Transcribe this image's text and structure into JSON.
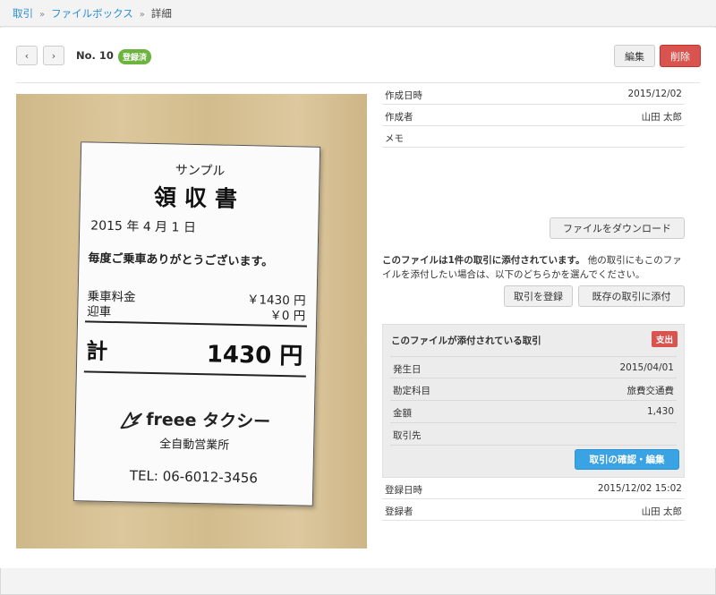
{
  "breadcrumb": {
    "items": [
      "取引",
      "ファイルボックス"
    ],
    "current": "詳細",
    "separator": "»"
  },
  "toolbar": {
    "prev_icon": "‹",
    "next_icon": "›",
    "doc_no": "No. 10",
    "status_badge": "登録済",
    "edit_label": "編集",
    "delete_label": "削除"
  },
  "receipt": {
    "sample": "サンプル",
    "title": "領収書",
    "date": "2015 年 4 月 1 日",
    "thanks": "毎度ご乗車ありがとうございます。",
    "fare_label": "乗車料金",
    "fare_value": "￥1430 円",
    "pickup_label": "迎車",
    "pickup_value": "￥0 円",
    "total_label": "計",
    "total_value": "1430 円",
    "brand": "freee タクシー",
    "office": "全自動営業所",
    "tel": "TEL: 06-6012-3456"
  },
  "file_info": [
    {
      "label": "作成日時",
      "value": "2015/12/02"
    },
    {
      "label": "作成者",
      "value": "山田 太郎"
    },
    {
      "label": "メモ",
      "value": ""
    }
  ],
  "download_label": "ファイルをダウンロード",
  "attach_note": {
    "bold": "このファイルは1件の取引に添付されています。",
    "rest": "他の取引にもこのファイルを添付したい場合は、以下のどちらかを選んでください。"
  },
  "register_deal_label": "取引を登録",
  "attach_existing_label": "既存の取引に添付",
  "deal": {
    "title": "このファイルが添付されている取引",
    "type_badge": "支出",
    "rows": [
      {
        "label": "発生日",
        "value": "2015/04/01"
      },
      {
        "label": "勘定科目",
        "value": "旅費交通費"
      },
      {
        "label": "金額",
        "value": "1,430"
      },
      {
        "label": "取引先",
        "value": ""
      }
    ],
    "confirm_label": "取引の確認・編集"
  },
  "registration": [
    {
      "label": "登録日時",
      "value": "2015/12/02 15:02"
    },
    {
      "label": "登録者",
      "value": "山田 太郎"
    }
  ],
  "colors": {
    "link": "#2a8fd0",
    "success": "#6cb33f",
    "danger": "#d9534f",
    "primary": "#3aa3e3"
  }
}
